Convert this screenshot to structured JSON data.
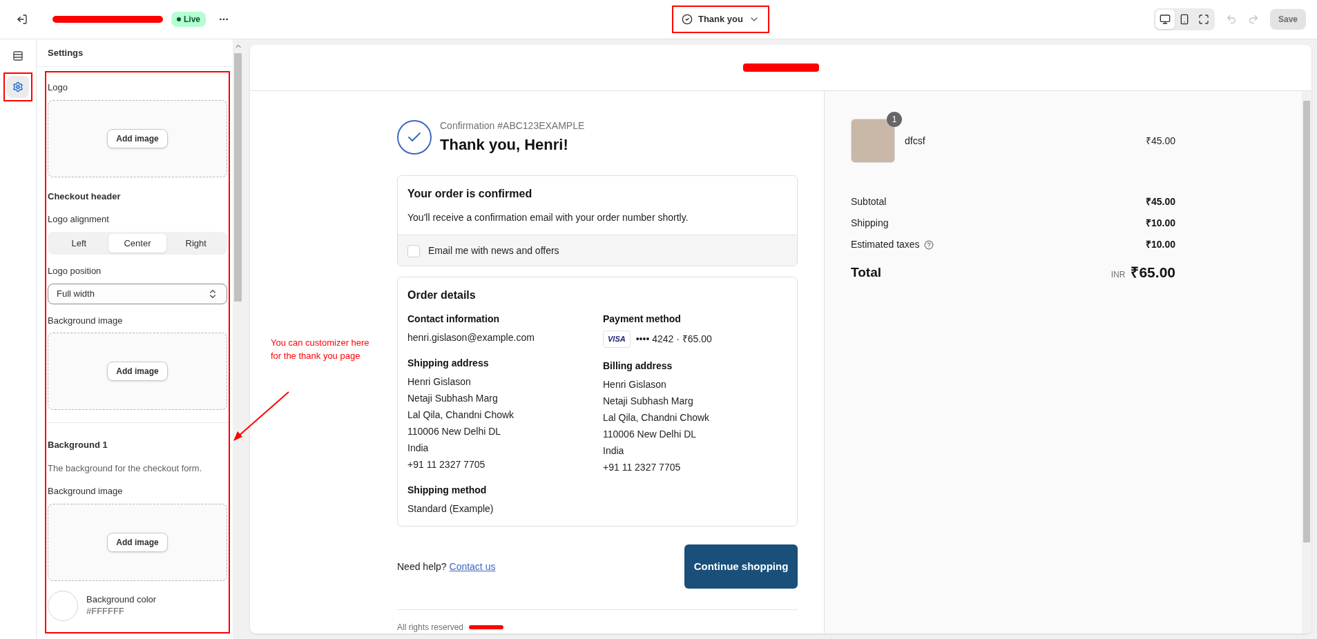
{
  "topbar": {
    "status": "Live",
    "page": "Thank you",
    "view_modes": [
      {
        "kind": "desktop",
        "selected": true
      },
      {
        "kind": "mobile",
        "selected": false
      },
      {
        "kind": "fullscreen",
        "selected": false
      }
    ],
    "save": {
      "label": "Save",
      "disabled": true
    }
  },
  "rail": [
    {
      "kind": "sections",
      "selected": false
    },
    {
      "kind": "settings",
      "selected": true
    }
  ],
  "settings": {
    "title": "Settings",
    "fields": [
      {
        "kind": "image",
        "label": "Logo",
        "button": "Add image"
      },
      {
        "kind": "heading",
        "label": "Checkout header"
      },
      {
        "kind": "segmented",
        "label": "Logo alignment",
        "options": [
          {
            "label": "Left",
            "selected": false
          },
          {
            "label": "Center",
            "selected": true
          },
          {
            "label": "Right",
            "selected": false
          }
        ]
      },
      {
        "kind": "select",
        "label": "Logo position",
        "value": "Full width"
      },
      {
        "kind": "image",
        "label": "Background image",
        "button": "Add image"
      },
      {
        "kind": "divider"
      },
      {
        "kind": "heading",
        "label": "Background 1"
      },
      {
        "kind": "description",
        "label": "The background for the checkout form."
      },
      {
        "kind": "image",
        "label": "Background image",
        "button": "Add image"
      },
      {
        "kind": "color",
        "label": "Background color",
        "value": "#FFFFFF",
        "color": "#ffffff"
      }
    ]
  },
  "annotation": {
    "lines": [
      "You can customizer here",
      "for the thank you page"
    ]
  },
  "preview": {
    "confirmation": "Confirmation #ABC123EXAMPLE",
    "title": "Thank you, Henri!",
    "status_card": {
      "title": "Your order is confirmed",
      "text": "You'll receive a confirmation email with your order number shortly.",
      "checkbox": {
        "label": "Email me with news and offers",
        "checked": false
      }
    },
    "details": {
      "title": "Order details",
      "columns": [
        [
          {
            "heading": "Contact information",
            "lines": [
              "henri.gislason@example.com"
            ]
          },
          {
            "heading": "Shipping address",
            "lines": [
              "Henri Gislason",
              "Netaji Subhash Marg",
              "Lal Qila, Chandni Chowk",
              "110006 New Delhi DL",
              "India",
              "+91 11 2327 7705"
            ]
          },
          {
            "heading": "Shipping method",
            "lines": [
              "Standard (Example)"
            ]
          }
        ],
        [
          {
            "heading": "Payment method",
            "card": {
              "brand": "VISA",
              "text": "•••• 4242 · ₹65.00"
            }
          },
          {
            "heading": "Billing address",
            "lines": [
              "Henri Gislason",
              "Netaji Subhash Marg",
              "Lal Qila, Chandni Chowk",
              "110006 New Delhi DL",
              "India",
              "+91 11 2327 7705"
            ]
          }
        ]
      ]
    },
    "help": {
      "text": "Need help?",
      "link": "Contact us"
    },
    "button": "Continue shopping",
    "footer": "All rights reserved"
  },
  "summary": {
    "items": [
      {
        "name": "dfcsf",
        "quantity": "1",
        "price": "₹45.00"
      }
    ],
    "lines": [
      {
        "label": "Subtotal",
        "value": "₹45.00",
        "info": false
      },
      {
        "label": "Shipping",
        "value": "₹10.00",
        "info": false
      },
      {
        "label": "Estimated taxes",
        "value": "₹10.00",
        "info": true
      }
    ],
    "total": {
      "label": "Total",
      "currency": "INR",
      "value": "₹65.00"
    }
  }
}
